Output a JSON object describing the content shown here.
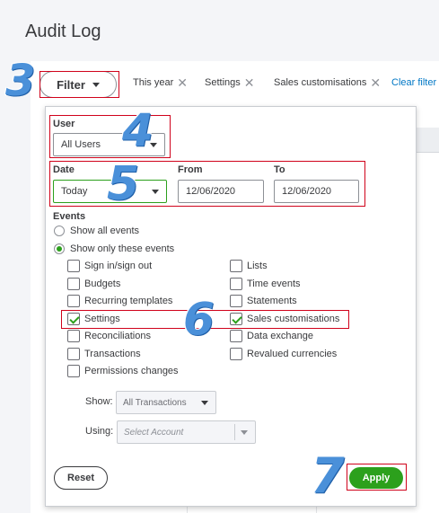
{
  "page": {
    "title": "Audit Log"
  },
  "filterbar": {
    "filter_label": "Filter",
    "chips": [
      {
        "label": "This year"
      },
      {
        "label": "Settings"
      },
      {
        "label": "Sales customisations"
      }
    ],
    "clear_label": "Clear filter /",
    "close_glyph": "✕"
  },
  "panel": {
    "user": {
      "label": "User",
      "value": "All Users"
    },
    "date": {
      "label": "Date",
      "value": "Today"
    },
    "from": {
      "label": "From",
      "value": "12/06/2020"
    },
    "to": {
      "label": "To",
      "value": "12/06/2020"
    },
    "events": {
      "label": "Events",
      "show_all": "Show all events",
      "show_only": "Show only these events",
      "selected_mode": "show_only",
      "left_column": [
        {
          "label": "Sign in/sign out",
          "checked": false
        },
        {
          "label": "Budgets",
          "checked": false
        },
        {
          "label": "Recurring templates",
          "checked": false
        },
        {
          "label": "Settings",
          "checked": true
        },
        {
          "label": "Reconciliations",
          "checked": false
        },
        {
          "label": "Transactions",
          "checked": false
        },
        {
          "label": "Permissions changes",
          "checked": false
        }
      ],
      "right_column": [
        {
          "label": "Lists",
          "checked": false
        },
        {
          "label": "Time events",
          "checked": false
        },
        {
          "label": "Statements",
          "checked": false
        },
        {
          "label": "Sales customisations",
          "checked": true
        },
        {
          "label": "Data exchange",
          "checked": false
        },
        {
          "label": "Revalued currencies",
          "checked": false
        }
      ]
    },
    "show": {
      "label": "Show:",
      "value": "All Transactions"
    },
    "using": {
      "label": "Using:",
      "placeholder": "Select Account"
    },
    "reset_label": "Reset",
    "apply_label": "Apply"
  },
  "annotations": {
    "step3": "3",
    "step4": "4",
    "step5": "5",
    "step6": "6",
    "step7": "7"
  },
  "colors": {
    "accent_green": "#2ca01c",
    "link_blue": "#0077c5",
    "highlight_red": "#d0021b",
    "step_blue": "#4a90d9"
  }
}
